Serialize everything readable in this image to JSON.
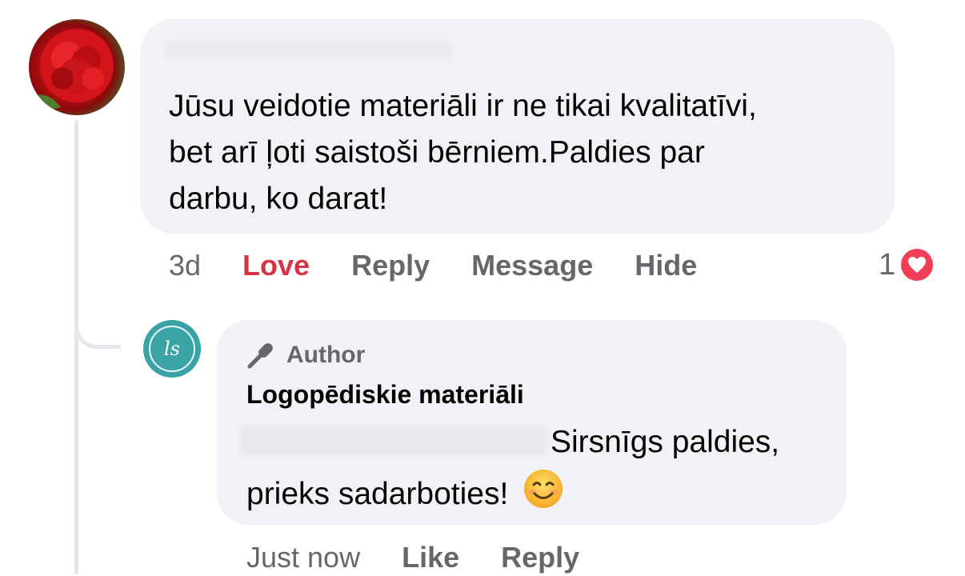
{
  "comment1": {
    "text_line1": "Jūsu veidotie materiāli ir ne tikai kvalitatīvi,",
    "text_line2": "bet arī ļoti saistoši bērniem.Paldies par",
    "text_line3": "darbu, ko darat!",
    "actions": {
      "time": "3d",
      "love": "Love",
      "reply": "Reply",
      "message": "Message",
      "hide": "Hide"
    },
    "reaction_count": "1",
    "reaction_icon": "heart-icon",
    "love_color": "#d63447"
  },
  "reply": {
    "author_badge_icon": "microphone-icon",
    "author_badge": "Author",
    "author_name": "Logopēdiskie materiāli",
    "avatar_initials": "ls",
    "text_line1": "Sirsnīgs paldies,",
    "text_line2": "prieks sadarboties!",
    "emoji_icon": "smiling-face-icon",
    "actions": {
      "time": "Just now",
      "like": "Like",
      "reply": "Reply"
    }
  },
  "colors": {
    "bubble": "#f0f2f5",
    "meta_text": "#65676b",
    "heart": "#f33e58",
    "avatar_teal": "#3aa3a6"
  }
}
